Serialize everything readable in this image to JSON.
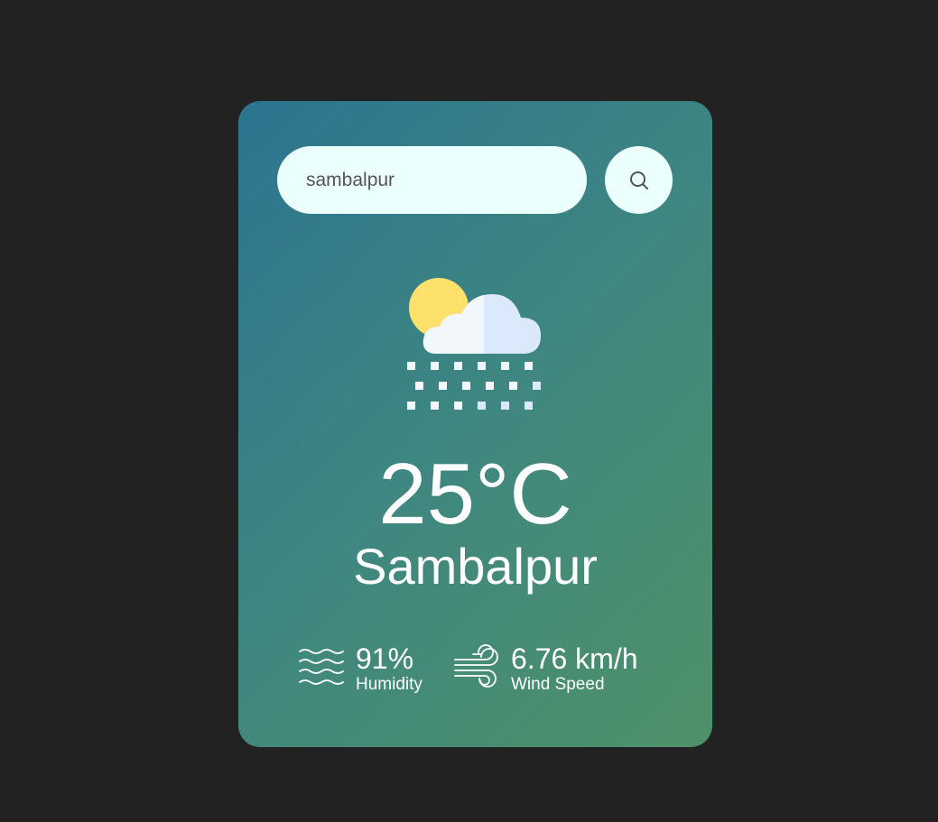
{
  "search": {
    "value": "sambalpur",
    "button_icon": "search-icon"
  },
  "weather": {
    "icon": "snow-sun-cloud-icon",
    "temperature": "25°C",
    "city": "Sambalpur"
  },
  "details": {
    "humidity": {
      "icon": "humidity-waves-icon",
      "value": "91%",
      "label": "Humidity"
    },
    "wind": {
      "icon": "wind-icon",
      "value": "6.76 km/h",
      "label": "Wind Speed"
    }
  },
  "colors": {
    "page_background": "#222222",
    "card_gradient_start": "#2b7490",
    "card_gradient_end": "#4f9168",
    "input_background": "#ebfffc",
    "text": "#ffffff"
  }
}
